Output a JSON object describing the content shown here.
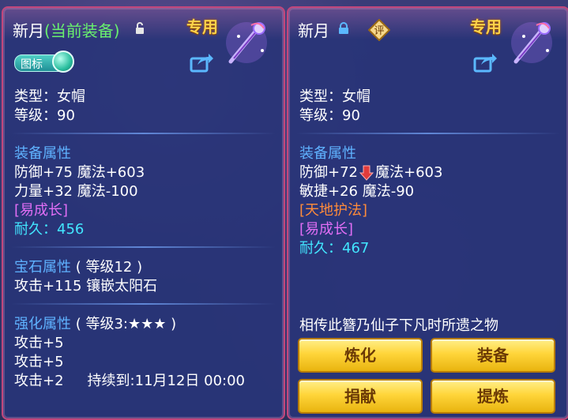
{
  "left_panel": {
    "name": "新月",
    "status": "(当前装备)",
    "special": "专用",
    "toggle_label": "图标",
    "type": "类型：女帽",
    "level": "等级：90",
    "equip_title": "装备属性",
    "attr1": "防御+75 魔法+603",
    "attr2": "力量+32 魔法-100",
    "tag": "[易成长]",
    "durability_label": "耐久：",
    "durability_value": "456",
    "gem_title": "宝石属性",
    "gem_level": "( 等级12 )",
    "gem_attr": "攻击+115 镶嵌太阳石",
    "enhance_title": "强化属性",
    "enhance_level": "( 等级3:★★★ )",
    "enh1": "攻击+5",
    "enh2": "攻击+5",
    "enh3": "攻击+2",
    "enh3_duration": "持续到:11月12日 00:00"
  },
  "right_panel": {
    "name": "新月",
    "eval_label": "评",
    "special": "专用",
    "type": "类型：女帽",
    "level": "等级：90",
    "equip_title": "装备属性",
    "attr1_a": "防御+72",
    "attr1_b": "魔法+603",
    "attr2": "敏捷+26 魔法-90",
    "tag1": "[天地护法]",
    "tag2": "[易成长]",
    "durability_label": "耐久：",
    "durability_value": "467",
    "description": "相传此簪乃仙子下凡时所遗之物",
    "buttons": [
      "炼化",
      "装备",
      "捐献",
      "提炼"
    ]
  },
  "colors": {
    "section": "#5fb2ff",
    "green": "#69f06e",
    "purple": "#e06ef5",
    "orange": "#ff8b3a",
    "cyan": "#42e6ff",
    "gold": "#ffd24a",
    "down_arrow": "#e23b3b"
  },
  "icons": [
    "lock-open-icon",
    "lock-icon",
    "share-icon",
    "weapon-hairpin-icon",
    "down-arrow-icon",
    "evaluate-icon"
  ]
}
